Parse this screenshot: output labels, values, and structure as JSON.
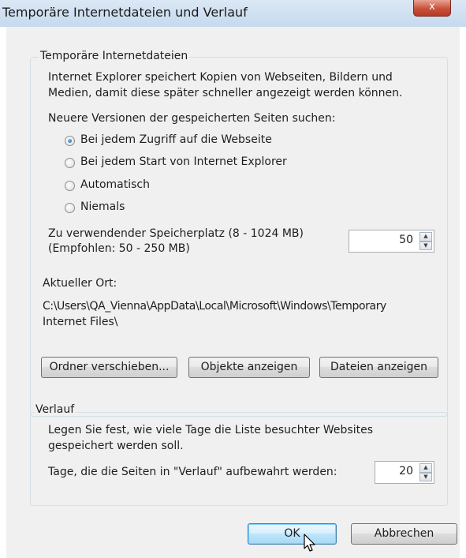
{
  "window": {
    "title": "Temporäre Internetdateien und Verlauf",
    "close_label": "x"
  },
  "temp_files": {
    "legend": "Temporäre Internetdateien",
    "description_line1": "Internet Explorer speichert Kopien von Webseiten, Bildern und",
    "description_line2": "Medien, damit diese später schneller angezeigt werden können.",
    "check_label": "Neuere Versionen der gespeicherten Seiten suchen:",
    "options": [
      {
        "label": "Bei jedem Zugriff auf die Webseite",
        "selected": true
      },
      {
        "label": "Bei jedem Start von Internet Explorer",
        "selected": false
      },
      {
        "label": "Automatisch",
        "selected": false
      },
      {
        "label": "Niemals",
        "selected": false
      }
    ],
    "space_label_line1": "Zu verwendender Speicherplatz (8 - 1024 MB)",
    "space_label_line2": "(Empfohlen: 50 - 250 MB)",
    "space_value": "50",
    "location_label": "Aktueller Ort:",
    "location_path_line1": "C:\\Users\\QA_Vienna\\AppData\\Local\\Microsoft\\Windows\\Temporary",
    "location_path_line2": "Internet Files\\",
    "buttons": {
      "move_folder": "Ordner verschieben...",
      "view_objects": "Objekte anzeigen",
      "view_files": "Dateien anzeigen"
    }
  },
  "history": {
    "legend": "Verlauf",
    "description_line1": "Legen Sie fest, wie viele Tage die Liste besuchter Websites",
    "description_line2": "gespeichert werden soll.",
    "days_label": "Tage, die die Seiten in \"Verlauf\" aufbewahrt werden:",
    "days_value": "20"
  },
  "footer": {
    "ok_label": "OK",
    "cancel_label": "Abbrechen"
  }
}
